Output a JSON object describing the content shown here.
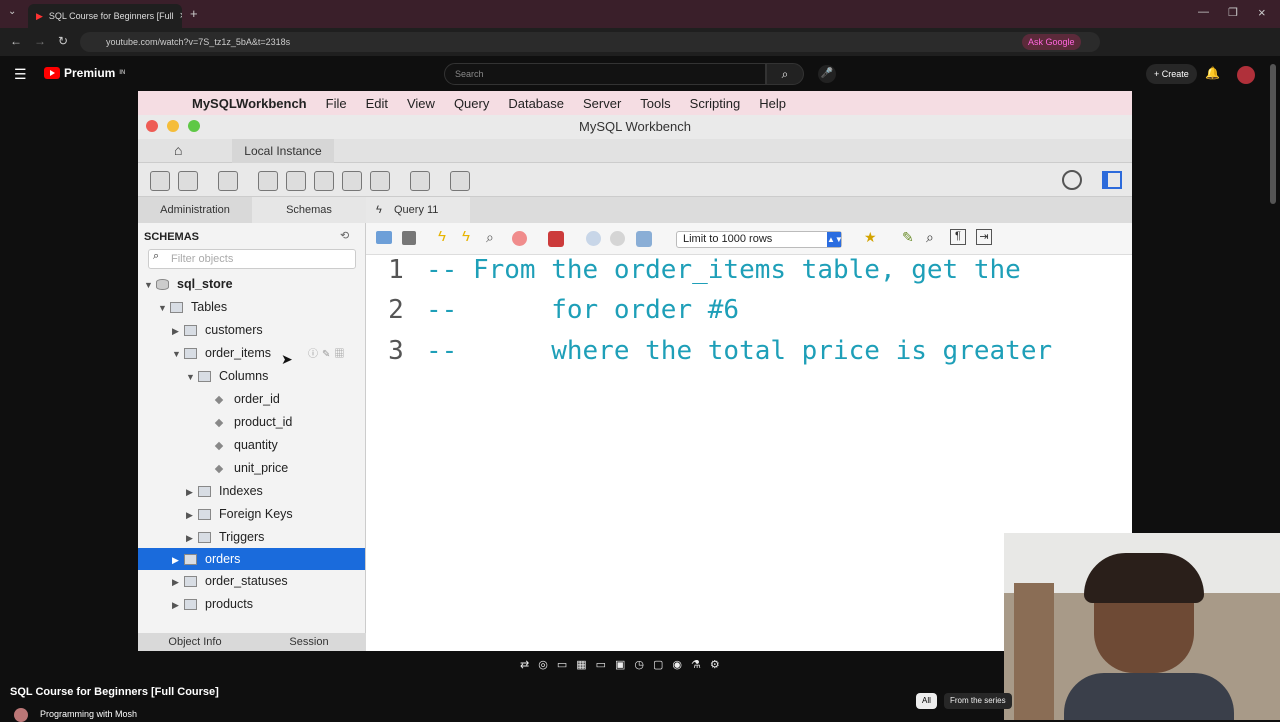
{
  "browser": {
    "tab_title": "SQL Course for Beginners [Full",
    "url": "youtube.com/watch?v=7S_tz1z_5bA&t=2318s",
    "ask_google": "Ask Google"
  },
  "youtube": {
    "logo": "Premium",
    "logo_sup": "IN",
    "search_placeholder": "Search",
    "create": "+ Create",
    "video_title": "SQL Course for Beginners [Full Course]",
    "channel": "Programming with Mosh",
    "chip_all": "All",
    "chip_series": "From the series"
  },
  "workbench": {
    "menu": [
      "File",
      "Edit",
      "View",
      "Query",
      "Database",
      "Server",
      "Tools",
      "Scripting",
      "Help"
    ],
    "app_name": "MySQLWorkbench",
    "window_title": "MySQL Workbench",
    "connection_tab": "Local Instance",
    "side_tabs": [
      "Administration",
      "Schemas"
    ],
    "query_tab": "Query 11",
    "schemas_header": "SCHEMAS",
    "filter_placeholder": "Filter objects",
    "tree": {
      "schema": "sql_store",
      "tables": "Tables",
      "customers": "customers",
      "order_items": "order_items",
      "columns": "Columns",
      "col1": "order_id",
      "col2": "product_id",
      "col3": "quantity",
      "col4": "unit_price",
      "indexes": "Indexes",
      "foreign_keys": "Foreign Keys",
      "triggers": "Triggers",
      "orders": "orders",
      "order_statuses": "order_statuses",
      "products": "products"
    },
    "side_footer": [
      "Object Info",
      "Session"
    ],
    "limit_rows": "Limit to 1000 rows",
    "code": [
      {
        "n": "1",
        "text": "-- From the order_items table, get the"
      },
      {
        "n": "2",
        "text": "--      for order #6"
      },
      {
        "n": "3",
        "text": "--      where the total price is greater"
      }
    ]
  }
}
